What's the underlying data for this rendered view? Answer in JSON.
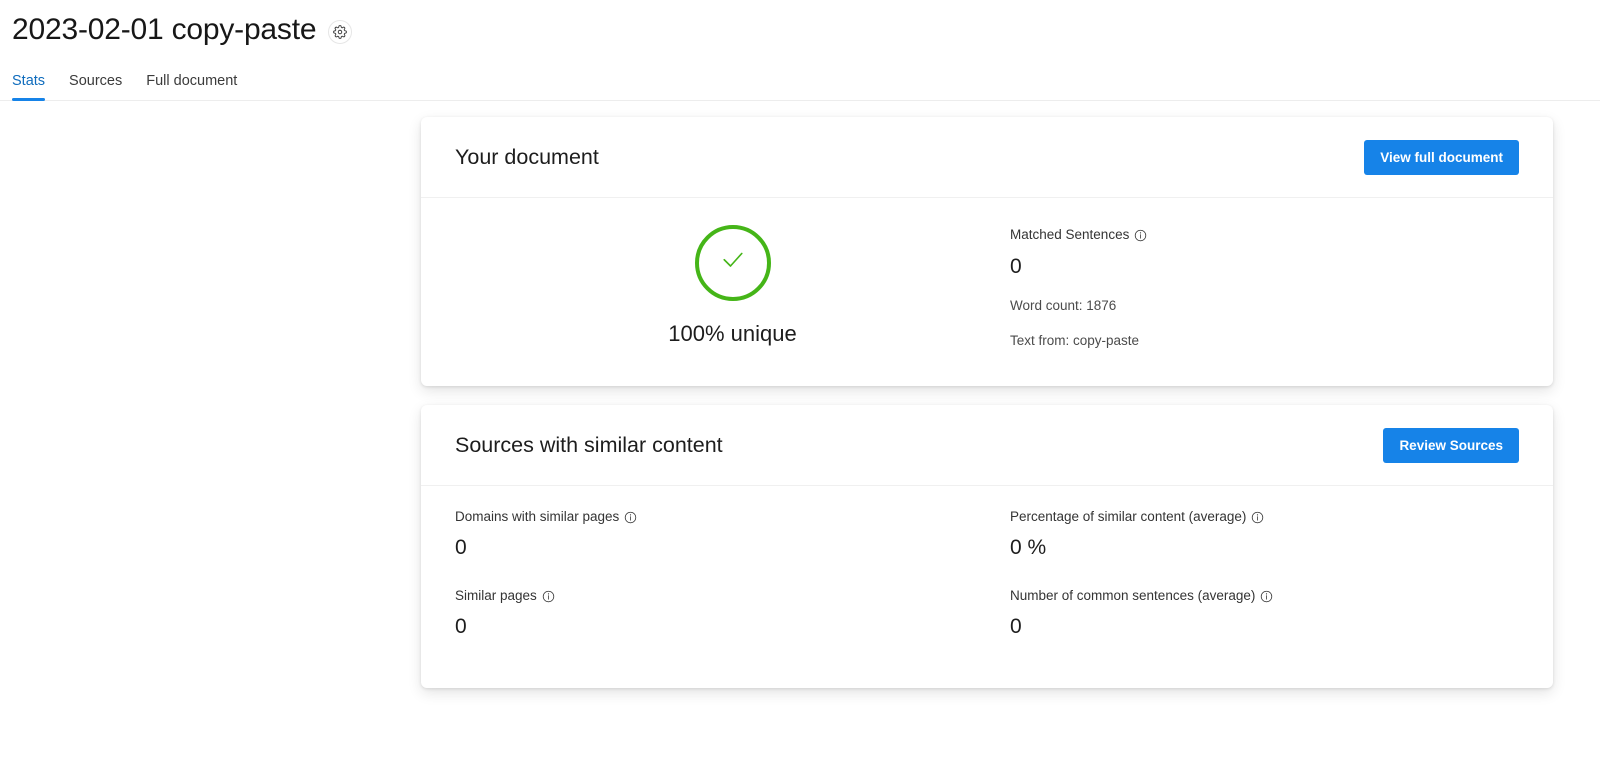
{
  "header": {
    "title": "2023-02-01 copy-paste",
    "settings_icon": "gear-icon"
  },
  "tabs": [
    {
      "label": "Stats",
      "active": true
    },
    {
      "label": "Sources",
      "active": false
    },
    {
      "label": "Full document",
      "active": false
    }
  ],
  "document_card": {
    "title": "Your document",
    "action_label": "View full document",
    "status_icon": "check-icon",
    "unique_label": "100% unique",
    "matched_sentences_label": "Matched Sentences",
    "matched_sentences_value": "0",
    "word_count": "Word count: 1876",
    "text_from": "Text from: copy-paste",
    "info_icon": "info-icon"
  },
  "sources_card": {
    "title": "Sources with similar content",
    "action_label": "Review Sources",
    "metrics": [
      {
        "label": "Domains with similar pages",
        "value": "0"
      },
      {
        "label": "Percentage of similar content (average)",
        "value": "0 %"
      },
      {
        "label": "Similar pages",
        "value": "0"
      },
      {
        "label": "Number of common sentences (average)",
        "value": "0"
      }
    ]
  },
  "colors": {
    "accent_blue": "#1683e8",
    "tab_active": "#0f6cbd",
    "success_green": "#45b518",
    "text_primary": "#1d1d1d"
  }
}
